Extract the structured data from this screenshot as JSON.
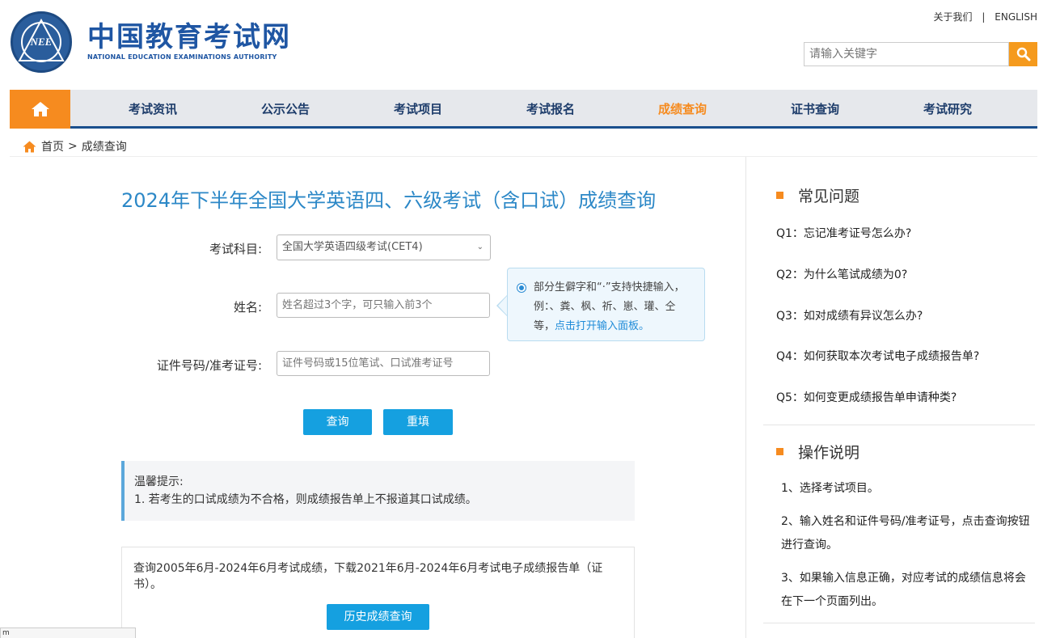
{
  "header": {
    "logo_text": "NEE",
    "site_title": "中国教育考试网",
    "site_subtitle": "NATIONAL EDUCATION EXAMINATIONS AUTHORITY",
    "links": {
      "about": "关于我们",
      "separator": "|",
      "english": "ENGLISH"
    },
    "search": {
      "placeholder": "请输入关键字"
    }
  },
  "nav": {
    "items": [
      {
        "label": "考试资讯"
      },
      {
        "label": "公示公告"
      },
      {
        "label": "考试项目"
      },
      {
        "label": "考试报名"
      },
      {
        "label": "成绩查询",
        "active": true
      },
      {
        "label": "证书查询"
      },
      {
        "label": "考试研究"
      }
    ]
  },
  "breadcrumb": {
    "home": "首页",
    "separator": ">",
    "current": "成绩查询"
  },
  "main": {
    "title": "2024年下半年全国大学英语四、六级考试（含口试）成绩查询",
    "form": {
      "subject_label": "考试科目:",
      "subject_value": "全国大学英语四级考试(CET4)",
      "name_label": "姓名:",
      "name_placeholder": "姓名超过3个字，可只输入前3个",
      "id_label": "证件号码/准考证号:",
      "id_placeholder": "证件号码或15位笔试、口试准考证号"
    },
    "tip": {
      "text": "部分生僻字和“·”支持快捷输入，例：、粪、枫、祈、崽、瓘、仝等，",
      "link": "点击打开输入面板。"
    },
    "buttons": {
      "query": "查询",
      "reset": "重填"
    },
    "notice": {
      "title": "温馨提示:",
      "line1": "1. 若考生的口试成绩为不合格，则成绩报告单上不报道其口试成绩。"
    },
    "history": {
      "text": "查询2005年6月-2024年6月考试成绩，下载2021年6月-2024年6月考试电子成绩报告单（证书）。",
      "button": "历史成绩查询"
    }
  },
  "sidebar": {
    "faq_title": "常见问题",
    "faqs": [
      "Q1：忘记准考证号怎么办?",
      "Q2：为什么笔试成绩为0?",
      "Q3：如对成绩有异议怎么办?",
      "Q4：如何获取本次考试电子成绩报告单?",
      "Q5：如何变更成绩报告单申请种类?"
    ],
    "ops_title": "操作说明",
    "ops": [
      "1、选择考试项目。",
      "2、输入姓名和证件号码/准考证号，点击查询按钮进行查询。",
      "3、如果输入信息正确，对应考试的成绩信息将会在下一个页面列出。"
    ]
  },
  "status_bar": {
    "text": "m"
  },
  "colors": {
    "brand_blue": "#1f56a3",
    "accent_orange": "#f68b1f",
    "button_blue": "#15a0e0",
    "title_blue": "#2c88c7"
  }
}
